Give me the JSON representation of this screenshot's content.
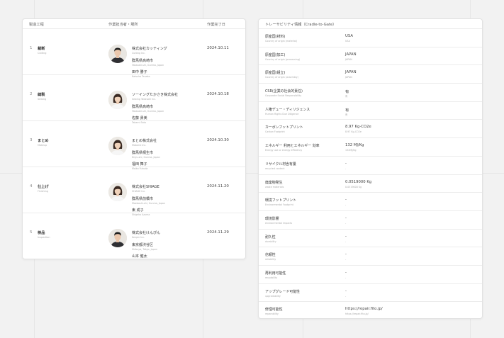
{
  "steps_table": {
    "headers": {
      "process": "製造工程",
      "owner": "作業担当者・場所",
      "date": "作業完了日"
    },
    "rows": [
      {
        "num": "1",
        "name": "裁断",
        "name_en": "Cutting",
        "company": "株式会社カッティング",
        "company_en": "Cutting Inc.",
        "city": "群馬県高崎市",
        "city_en": "Takasaki-shi, Gunma, Japan",
        "person": "田中 勝子",
        "person_en": "Katsuko Tanaka",
        "date": "2024.10.11",
        "avatar": "male"
      },
      {
        "num": "2",
        "name": "縫製",
        "name_en": "Sewing",
        "company": "ソーイングたかさき株式会社",
        "company_en": "Sewing Takasaki Inc.",
        "city": "群馬県高崎市",
        "city_en": "Takasaki-shi, Gunma, Japan",
        "person": "佐藤 貴美",
        "person_en": "Takami Sato",
        "date": "2024.10.18",
        "avatar": "female"
      },
      {
        "num": "3",
        "name": "まとめ",
        "name_en": "Makeup",
        "company": "まとめ株式会社",
        "company_en": "Matome Inc.",
        "city": "群馬県桐生市",
        "city_en": "Kiryu-shi, Gunma, Japan",
        "person": "福田 舞子",
        "person_en": "Maiko Fukuda",
        "date": "2024.10.30",
        "avatar": "female"
      },
      {
        "num": "4",
        "name": "仕上げ",
        "name_en": "Finishing",
        "company": "株式会社SHIAGE",
        "company_en": "SHIAGE Inc.",
        "city": "群馬県前橋市",
        "city_en": "Maebashi-shi, Gunma, Japan",
        "person": "東 成子",
        "person_en": "Shigeko Azuma",
        "date": "2024.11.20",
        "avatar": "female"
      },
      {
        "num": "5",
        "name": "検品",
        "name_en": "Inspection",
        "company": "株式会社けんぴん",
        "company_en": "Kenpin Inc.",
        "city": "東京都渋谷区",
        "city_en": "Shibuya, Tokyo, Japan",
        "person": "山本 健太",
        "person_en": "Kenta Yamamoto",
        "date": "2024.11.29",
        "avatar": "male"
      }
    ]
  },
  "traceability": {
    "title": "トレーサビリティ情報（Cradle-to-Gate）",
    "rows": [
      {
        "label": "原産国(材料)",
        "label_en": "Country of origin (material)",
        "value": "USA",
        "sub": "USA"
      },
      {
        "label": "原産国(加工)",
        "label_en": "Country of origin (processing)",
        "value": "JAPAN",
        "sub": "JAPAN"
      },
      {
        "label": "原産国(組立)",
        "label_en": "Country of origin (assembly)",
        "value": "JAPAN",
        "sub": "JAPAN"
      },
      {
        "label": "CSR(企業の社会的責任)",
        "label_en": "Corporate Social Responsibility",
        "value": "有",
        "sub": "有"
      },
      {
        "label": "人権デュー・ディリジェンス",
        "label_en": "Human Rights Due Diligence",
        "value": "有",
        "sub": "有"
      },
      {
        "label": "カーボンフットプリント",
        "label_en": "Carbon Footprint",
        "value": "8.97 Kg-CO2e",
        "sub": "8.97 Kg-CO2e"
      },
      {
        "label": "エネルギー 利用とエネルギー 効率",
        "label_en": "Energy use or energy efficiency",
        "value": "132 MJ/Kg",
        "sub": "132MJ/Kg"
      },
      {
        "label": "リサイクル材含有量",
        "label_en": "recycled content",
        "value": "-",
        "sub": "-"
      },
      {
        "label": "廃棄物発生",
        "label_en": "waste materials",
        "value": "0.0519000 Kg",
        "sub": "0.0519000 Kg"
      },
      {
        "label": "環境フットプリント",
        "label_en": "Environmental Footprint",
        "value": "-",
        "sub": "-"
      },
      {
        "label": "環境影響",
        "label_en": "environmental impacts",
        "value": "-",
        "sub": "-"
      },
      {
        "label": "耐久性",
        "label_en": "durability",
        "value": "-",
        "sub": "-"
      },
      {
        "label": "信頼性",
        "label_en": "reliability",
        "value": "-",
        "sub": "-"
      },
      {
        "label": "再利用可能性",
        "label_en": "reusability",
        "value": "-",
        "sub": "-"
      },
      {
        "label": "アップグレード可能性",
        "label_en": "upgradability",
        "value": "-",
        "sub": "-"
      },
      {
        "label": "修理可能性",
        "label_en": "reparability",
        "value": "https://repair.fito.jp/",
        "sub": "https://repair.fito.jp/"
      }
    ]
  }
}
